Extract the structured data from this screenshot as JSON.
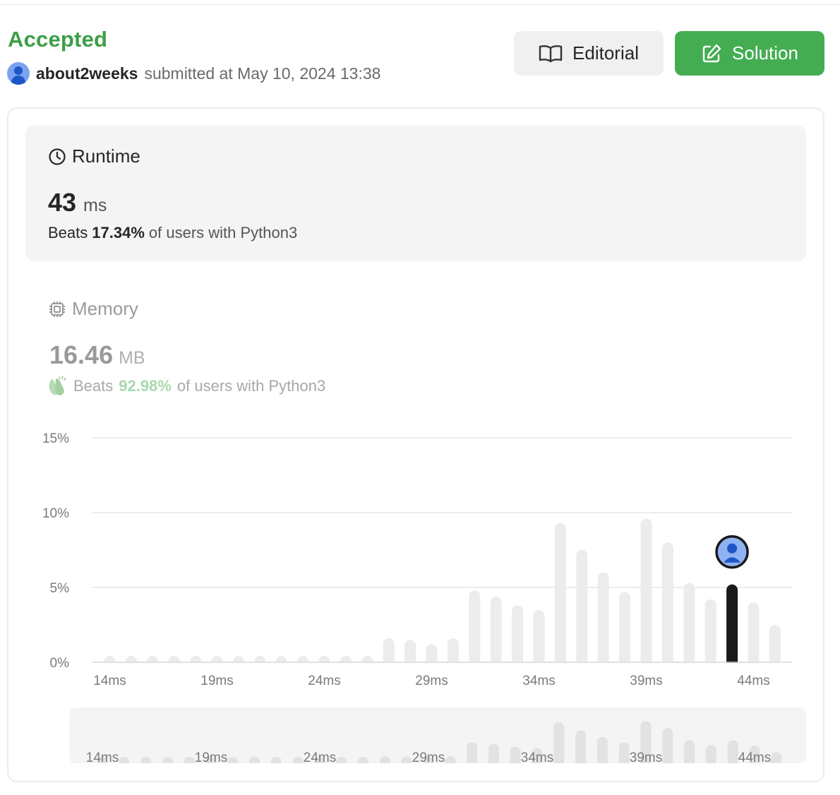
{
  "submission": {
    "status": "Accepted",
    "username": "about2weeks",
    "submitted_text": "submitted at May 10, 2024 13:38",
    "status_color": "#3d9e47"
  },
  "buttons": {
    "editorial": "Editorial",
    "solution": "Solution",
    "solution_color": "#44ad52"
  },
  "runtime": {
    "title": "Runtime",
    "value": "43",
    "unit": "ms",
    "beats_label": "Beats",
    "beats_pct": "17.34%",
    "beats_suffix": "of users with Python3"
  },
  "memory": {
    "title": "Memory",
    "value": "16.46",
    "unit": "MB",
    "beats_label": "Beats",
    "beats_pct": "92.98%",
    "beats_suffix": "of users with Python3"
  },
  "chart_data": {
    "type": "bar",
    "title": "",
    "xlabel": "",
    "ylabel": "",
    "y_ticks": [
      "0%",
      "5%",
      "10%",
      "15%"
    ],
    "ylim": [
      0,
      15
    ],
    "grid": true,
    "x_ticks": [
      "14ms",
      "19ms",
      "24ms",
      "29ms",
      "34ms",
      "39ms",
      "44ms"
    ],
    "x": [
      14,
      15,
      16,
      17,
      18,
      19,
      20,
      21,
      22,
      23,
      24,
      25,
      26,
      27,
      28,
      29,
      30,
      31,
      32,
      33,
      34,
      35,
      36,
      37,
      38,
      39,
      40,
      41,
      42,
      43,
      44,
      45
    ],
    "values": [
      0.3,
      0.3,
      0.3,
      0.3,
      0.3,
      0.3,
      0.3,
      0.3,
      0.3,
      0.3,
      0.3,
      0.3,
      0.4,
      1.6,
      1.5,
      1.2,
      1.6,
      4.8,
      4.4,
      3.8,
      3.5,
      9.3,
      7.5,
      6.0,
      4.7,
      9.6,
      8.0,
      5.3,
      4.2,
      5.2,
      4.0,
      2.5
    ],
    "highlight_x": 43,
    "highlight_color": "#1a1a1a",
    "bar_color": "#ececec"
  },
  "overview_chart": {
    "x_ticks": [
      "14ms",
      "19ms",
      "24ms",
      "29ms",
      "34ms",
      "39ms",
      "44ms"
    ]
  }
}
